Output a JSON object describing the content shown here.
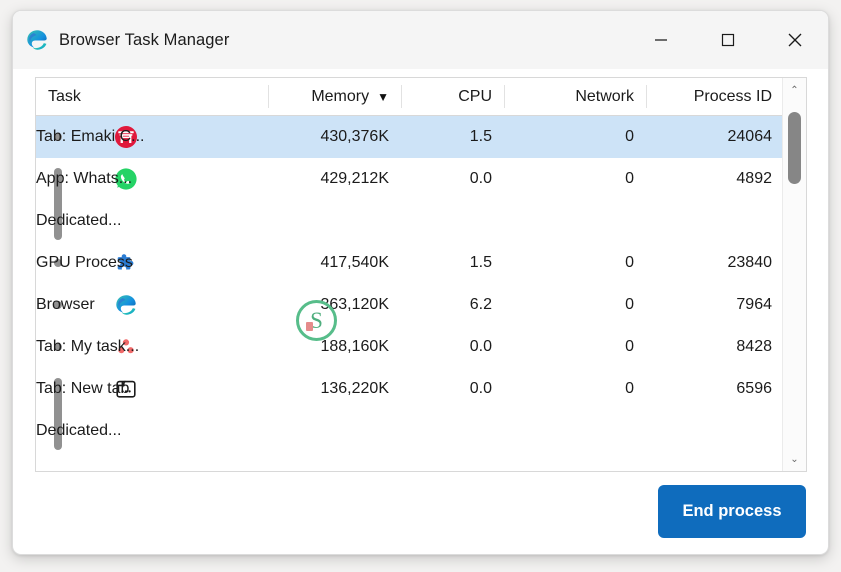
{
  "window": {
    "title": "Browser Task Manager",
    "app_icon": "edge-logo-icon",
    "controls": {
      "minimize_label": "Minimize",
      "maximize_label": "Maximize",
      "close_label": "Close"
    }
  },
  "table": {
    "columns": [
      {
        "key": "task",
        "label": "Task",
        "align": "left",
        "sorted": false
      },
      {
        "key": "memory",
        "label": "Memory",
        "align": "right",
        "sorted": true,
        "sort_arrow": "▼"
      },
      {
        "key": "cpu",
        "label": "CPU",
        "align": "right",
        "sorted": false
      },
      {
        "key": "network",
        "label": "Network",
        "align": "right",
        "sorted": false
      },
      {
        "key": "pid",
        "label": "Process ID",
        "align": "right",
        "sorted": false
      }
    ],
    "rows": [
      {
        "task": "Tab: Emaki C...",
        "memory": "430,376K",
        "cpu": "1.5",
        "network": "0",
        "pid": "24064",
        "icon": "torii-gate-icon",
        "selected": true,
        "marker": "dot"
      },
      {
        "task": "App: Whats...",
        "memory": "429,212K",
        "cpu": "0.0",
        "network": "0",
        "pid": "4892",
        "icon": "whatsapp-icon",
        "selected": false,
        "marker": "bar-start"
      },
      {
        "task": "Dedicated...",
        "memory": "",
        "cpu": "",
        "network": "",
        "pid": "",
        "icon": "none",
        "selected": false,
        "marker": "bar-end"
      },
      {
        "task": "GPU Process",
        "memory": "417,540K",
        "cpu": "1.5",
        "network": "0",
        "pid": "23840",
        "icon": "puzzle-piece-icon",
        "selected": false,
        "marker": "dot"
      },
      {
        "task": "Browser",
        "memory": "363,120K",
        "cpu": "6.2",
        "network": "0",
        "pid": "7964",
        "icon": "edge-logo-icon",
        "selected": false,
        "marker": "dot"
      },
      {
        "task": "Tab: My task...",
        "memory": "188,160K",
        "cpu": "0.0",
        "network": "0",
        "pid": "8428",
        "icon": "asana-dots-icon",
        "selected": false,
        "marker": "dot"
      },
      {
        "task": "Tab: New tab",
        "memory": "136,220K",
        "cpu": "0.0",
        "network": "0",
        "pid": "6596",
        "icon": "new-tab-icon",
        "selected": false,
        "marker": "bar-start"
      },
      {
        "task": "Dedicated...",
        "memory": "",
        "cpu": "",
        "network": "",
        "pid": "",
        "icon": "none",
        "selected": false,
        "marker": "bar-end"
      }
    ]
  },
  "scrollbar": {
    "up_arrow": "⌃",
    "down_arrow": "⌄"
  },
  "footer": {
    "end_process_label": "End process"
  },
  "cursor": {
    "glyph": "S"
  },
  "colors": {
    "accent": "#0f6cbd",
    "selection": "#cde3f7",
    "cursor_ring": "#57bd8a",
    "titlebar": "#f5f5f5",
    "text": "#1b1b1b"
  }
}
